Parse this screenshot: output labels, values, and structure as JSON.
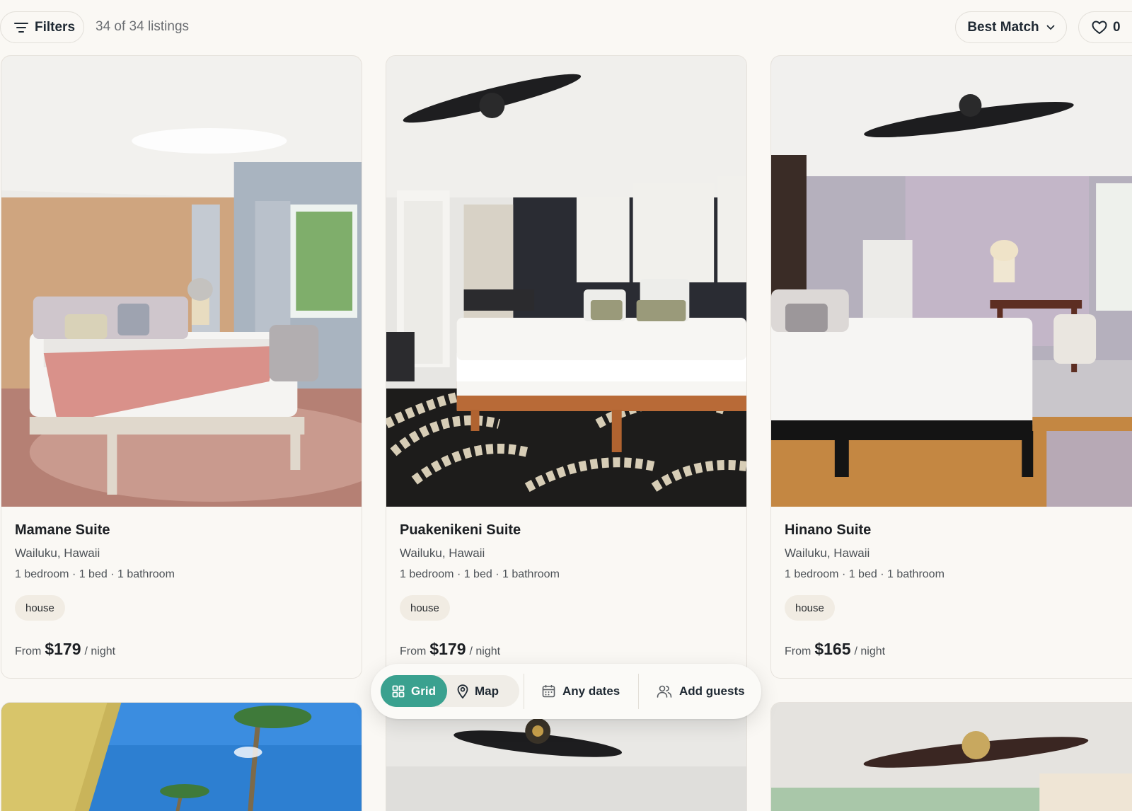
{
  "toolbar": {
    "filters_label": "Filters",
    "count_label": "34 of 34 listings",
    "sort_label": "Best Match",
    "favorites_count": "0"
  },
  "listings": [
    {
      "title": "Mamane Suite",
      "location": "Wailuku, Hawaii",
      "specs": "1 bedroom · 1 bed · 1 bathroom",
      "tag": "house",
      "price_prefix": "From",
      "price": "$179",
      "price_suffix": "/ night"
    },
    {
      "title": "Puakenikeni Suite",
      "location": "Wailuku, Hawaii",
      "specs": "1 bedroom · 1 bed · 1 bathroom",
      "tag": "house",
      "price_prefix": "From",
      "price": "$179",
      "price_suffix": "/ night"
    },
    {
      "title": "Hinano Suite",
      "location": "Wailuku, Hawaii",
      "specs": "1 bedroom · 1 bed · 1 bathroom",
      "tag": "house",
      "price_prefix": "From",
      "price": "$165",
      "price_suffix": "/ night"
    }
  ],
  "view_bar": {
    "grid_label": "Grid",
    "map_label": "Map",
    "dates_label": "Any dates",
    "guests_label": "Add guests"
  },
  "colors": {
    "accent": "#3aa18f",
    "background": "#faf8f4",
    "tag_bg": "#f1ece3"
  },
  "icons": [
    "filter-icon",
    "chevron-down-icon",
    "heart-icon",
    "grid-icon",
    "map-pin-icon",
    "calendar-icon",
    "users-icon"
  ]
}
